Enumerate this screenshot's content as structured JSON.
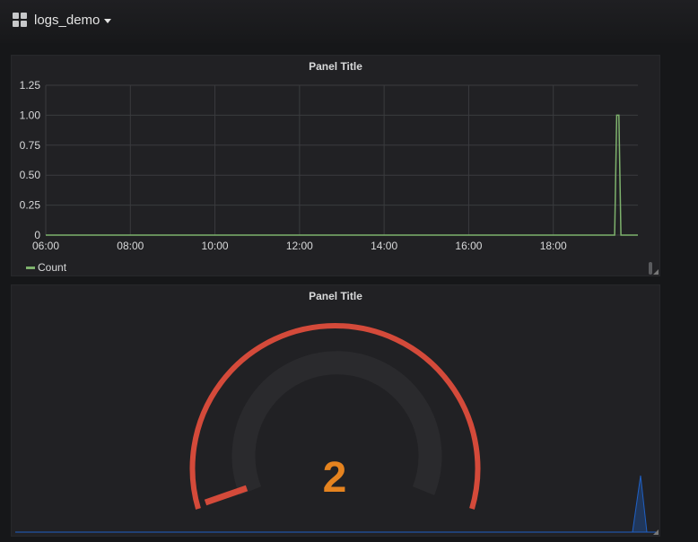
{
  "header": {
    "dashboard_title": "logs_demo"
  },
  "panels": [
    {
      "title": "Panel Title",
      "legend": [
        {
          "label": "Count",
          "color": "#7eb26d"
        }
      ]
    },
    {
      "title": "Panel Title",
      "gauge": {
        "value": "2",
        "value_color": "#e5831f",
        "threshold_color": "#d44a3a"
      },
      "sparkline_color": "#1f60c4"
    }
  ],
  "chart_data": {
    "type": "line",
    "title": "Panel Title",
    "xlabel": "",
    "ylabel": "",
    "x_ticks": [
      "06:00",
      "08:00",
      "10:00",
      "12:00",
      "14:00",
      "16:00",
      "18:00"
    ],
    "y_ticks": [
      "0",
      "0.25",
      "0.50",
      "0.75",
      "1.00",
      "1.25"
    ],
    "ylim": [
      0,
      1.25
    ],
    "xlim_hours": [
      6.0,
      20.0
    ],
    "grid": true,
    "legend_position": "bottom-left",
    "series": [
      {
        "name": "Count",
        "color": "#7eb26d",
        "points": [
          [
            6.0,
            0
          ],
          [
            19.45,
            0
          ],
          [
            19.5,
            1
          ],
          [
            19.55,
            1
          ],
          [
            19.6,
            0
          ],
          [
            20.0,
            0
          ]
        ]
      }
    ]
  }
}
